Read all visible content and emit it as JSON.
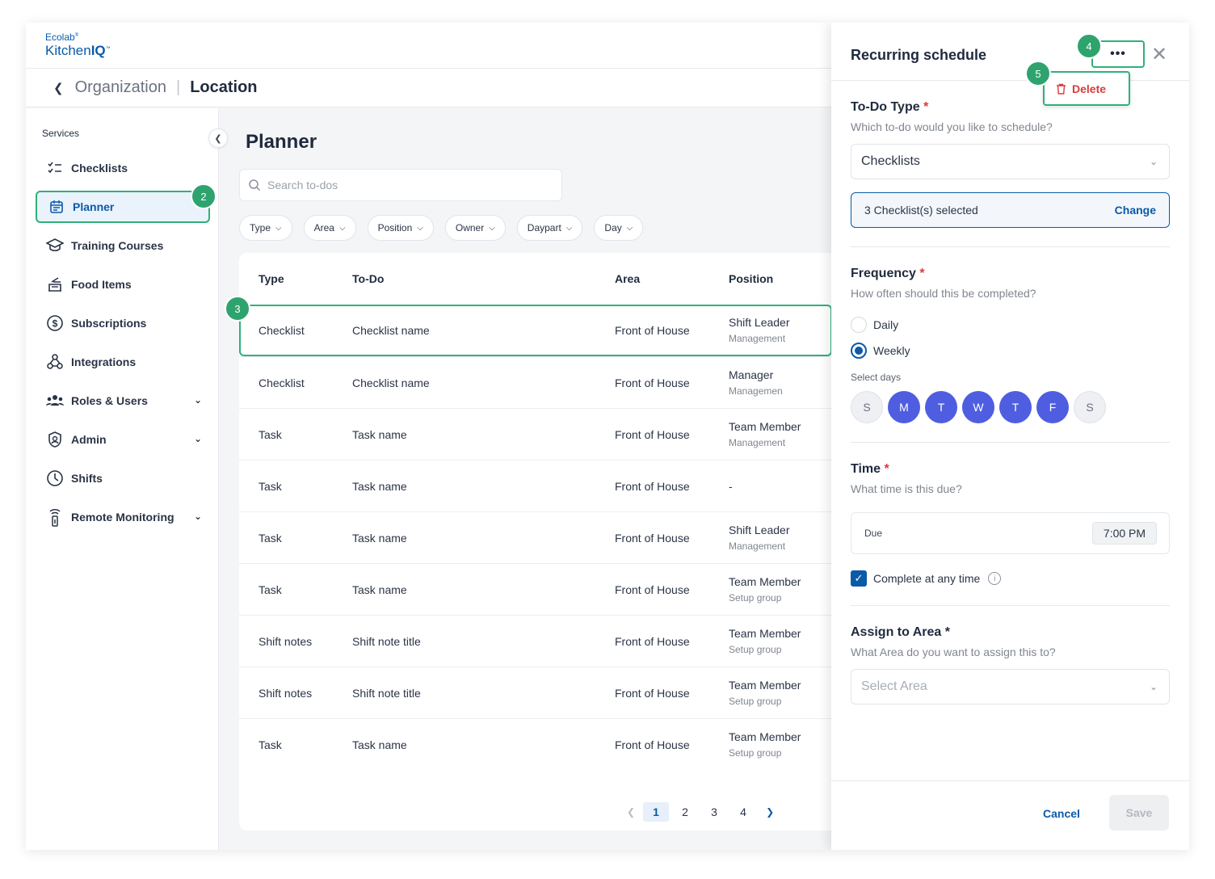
{
  "app": {
    "brand_top": "Ecolab",
    "brand_main_a": "Kitchen",
    "brand_main_b": "IQ",
    "trademark": "™"
  },
  "breadcrumb": {
    "parent": "Organization",
    "current": "Location"
  },
  "sidebar": {
    "section_title": "Services",
    "items": [
      {
        "label": "Checklists",
        "icon": "checklist-icon"
      },
      {
        "label": "Planner",
        "icon": "calendar-icon",
        "active": true
      },
      {
        "label": "Training Courses",
        "icon": "graduation-cap-icon"
      },
      {
        "label": "Food Items",
        "icon": "food-tray-icon"
      },
      {
        "label": "Subscriptions",
        "icon": "dollar-circle-icon"
      },
      {
        "label": "Integrations",
        "icon": "webhook-icon"
      },
      {
        "label": "Roles & Users",
        "icon": "users-icon",
        "expandable": true
      },
      {
        "label": "Admin",
        "icon": "shield-icon",
        "expandable": true
      },
      {
        "label": "Shifts",
        "icon": "clock-icon"
      },
      {
        "label": "Remote Monitoring",
        "icon": "thermometer-icon",
        "expandable": true
      }
    ]
  },
  "annotations": {
    "b2": "2",
    "b3": "3",
    "b4": "4",
    "b5": "5"
  },
  "planner": {
    "title": "Planner",
    "search_placeholder": "Search to-dos",
    "filters": [
      "Type",
      "Area",
      "Position",
      "Owner",
      "Daypart",
      "Day"
    ],
    "columns": {
      "type": "Type",
      "todo": "To-Do",
      "area": "Area",
      "position": "Position"
    },
    "rows": [
      {
        "type": "Checklist",
        "todo": "Checklist name",
        "area": "Front of House",
        "pos1": "Shift Leader",
        "pos2": "Management"
      },
      {
        "type": "Checklist",
        "todo": "Checklist name",
        "area": "Front of House",
        "pos1": "Manager",
        "pos2": "Managemen"
      },
      {
        "type": "Task",
        "todo": "Task name",
        "area": "Front of House",
        "pos1": "Team Member",
        "pos2": "Management"
      },
      {
        "type": "Task",
        "todo": "Task name",
        "area": "Front of House",
        "pos1": "-",
        "pos2": ""
      },
      {
        "type": "Task",
        "todo": "Task name",
        "area": "Front of House",
        "pos1": "Shift Leader",
        "pos2": "Management"
      },
      {
        "type": "Task",
        "todo": "Task name",
        "area": "Front of House",
        "pos1": "Team Member",
        "pos2": "Setup group"
      },
      {
        "type": "Shift notes",
        "todo": "Shift note title",
        "area": "Front of House",
        "pos1": "Team Member",
        "pos2": "Setup group"
      },
      {
        "type": "Shift notes",
        "todo": "Shift note title",
        "area": "Front of House",
        "pos1": "Team Member",
        "pos2": "Setup group"
      },
      {
        "type": "Task",
        "todo": "Task name",
        "area": "Front of House",
        "pos1": "Team Member",
        "pos2": "Setup group"
      }
    ],
    "pagination": {
      "pages": [
        "1",
        "2",
        "3",
        "4"
      ],
      "current": "1"
    }
  },
  "drawer": {
    "title": "Recurring schedule",
    "more_label": "•••",
    "close_label": "✕",
    "menu_delete": "Delete",
    "todo_type": {
      "title": "To-Do Type",
      "required": "*",
      "subtitle": "Which to-do would you like to schedule?",
      "value": "Checklists",
      "selection_text": "3 Checklist(s) selected",
      "change_label": "Change"
    },
    "frequency": {
      "title": "Frequency",
      "required": "*",
      "subtitle": "How often should this be completed?",
      "options": [
        "Daily",
        "Weekly"
      ],
      "selected": "Weekly",
      "days_label": "Select days",
      "days": [
        {
          "label": "S",
          "on": false
        },
        {
          "label": "M",
          "on": true
        },
        {
          "label": "T",
          "on": true
        },
        {
          "label": "W",
          "on": true
        },
        {
          "label": "T",
          "on": true
        },
        {
          "label": "F",
          "on": true
        },
        {
          "label": "S",
          "on": false
        }
      ]
    },
    "time": {
      "title": "Time",
      "required": "*",
      "subtitle": "What time is this due?",
      "due_label": "Due",
      "due_value": "7:00 PM",
      "anytime_label": "Complete at any time",
      "anytime_checked": true
    },
    "assign": {
      "title": "Assign to Area *",
      "subtitle": "What Area do you want to assign this to?",
      "placeholder": "Select Area"
    },
    "footer": {
      "cancel": "Cancel",
      "save": "Save"
    }
  },
  "colors": {
    "brand_blue": "#0a5aa8",
    "highlight_green": "#2fb179",
    "day_on": "#4f5ee0",
    "danger": "#d93b3b"
  }
}
